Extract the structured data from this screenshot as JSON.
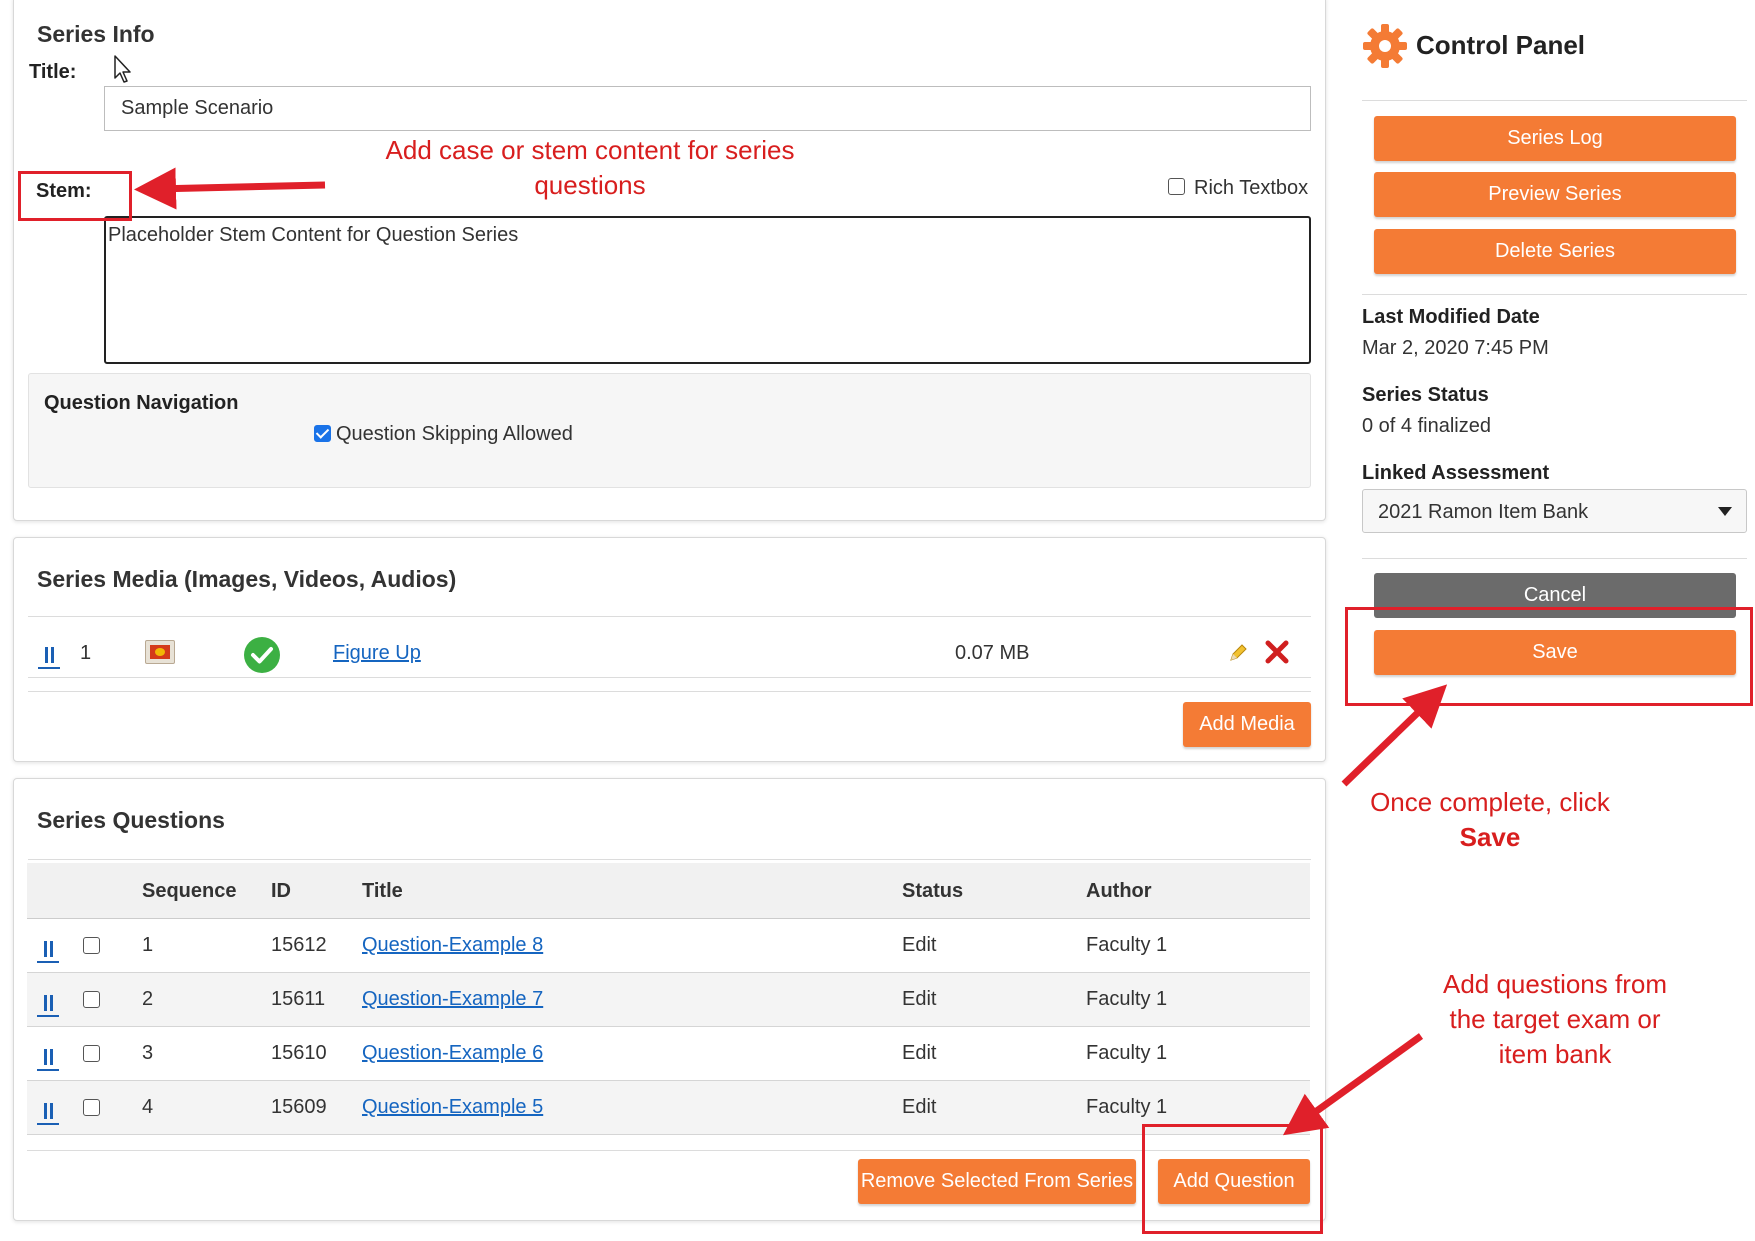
{
  "series_info": {
    "heading": "Series Info",
    "title_label": "Title:",
    "title_value": "Sample Scenario",
    "stem_label": "Stem:",
    "rich_textbox_label": "Rich Textbox",
    "rich_textbox_checked": false,
    "stem_value": "Placeholder Stem Content for Question Series",
    "navigation_heading": "Question Navigation",
    "skipping_label": "Question Skipping Allowed",
    "skipping_checked": true
  },
  "series_media": {
    "heading": "Series Media (Images, Videos, Audios)",
    "items": [
      {
        "index": "1",
        "name": "Figure Up",
        "size": "0.07 MB",
        "status_icon": "check-circle-icon",
        "thumb_icon": "image-thumbnail-icon"
      }
    ],
    "add_media_label": "Add Media"
  },
  "series_questions": {
    "heading": "Series Questions",
    "columns": [
      "Sequence",
      "ID",
      "Title",
      "Status",
      "Author"
    ],
    "rows": [
      {
        "sequence": "1",
        "id": "15612",
        "title": "Question-Example 8",
        "status": "Edit",
        "author": "Faculty 1"
      },
      {
        "sequence": "2",
        "id": "15611",
        "title": "Question-Example 7",
        "status": "Edit",
        "author": "Faculty 1"
      },
      {
        "sequence": "3",
        "id": "15610",
        "title": "Question-Example 6",
        "status": "Edit",
        "author": "Faculty 1"
      },
      {
        "sequence": "4",
        "id": "15609",
        "title": "Question-Example 5",
        "status": "Edit",
        "author": "Faculty 1"
      }
    ],
    "remove_label": "Remove Selected From Series",
    "add_question_label": "Add Question"
  },
  "control_panel": {
    "title": "Control Panel",
    "icon": "gear-icon",
    "series_log_label": "Series Log",
    "preview_label": "Preview Series",
    "delete_label": "Delete Series",
    "last_modified_label": "Last Modified Date",
    "last_modified_value": "Mar 2, 2020 7:45 PM",
    "status_label": "Series Status",
    "status_value": "0 of 4 finalized",
    "linked_label": "Linked Assessment",
    "linked_value": "2021 Ramon Item Bank",
    "cancel_label": "Cancel",
    "save_label": "Save"
  },
  "annotations": {
    "stem_note_line1": "Add case or stem content for series",
    "stem_note_line2": "questions",
    "save_note_line1": "Once complete, click",
    "save_note_line2": "Save",
    "add_note_line1": "Add questions from",
    "add_note_line2": "the target exam or",
    "add_note_line3": "item bank"
  },
  "colors": {
    "accent_orange": "#f47b35",
    "link_blue": "#1565c0",
    "annotation_red": "#d81e1e",
    "success_green": "#3cb043"
  }
}
